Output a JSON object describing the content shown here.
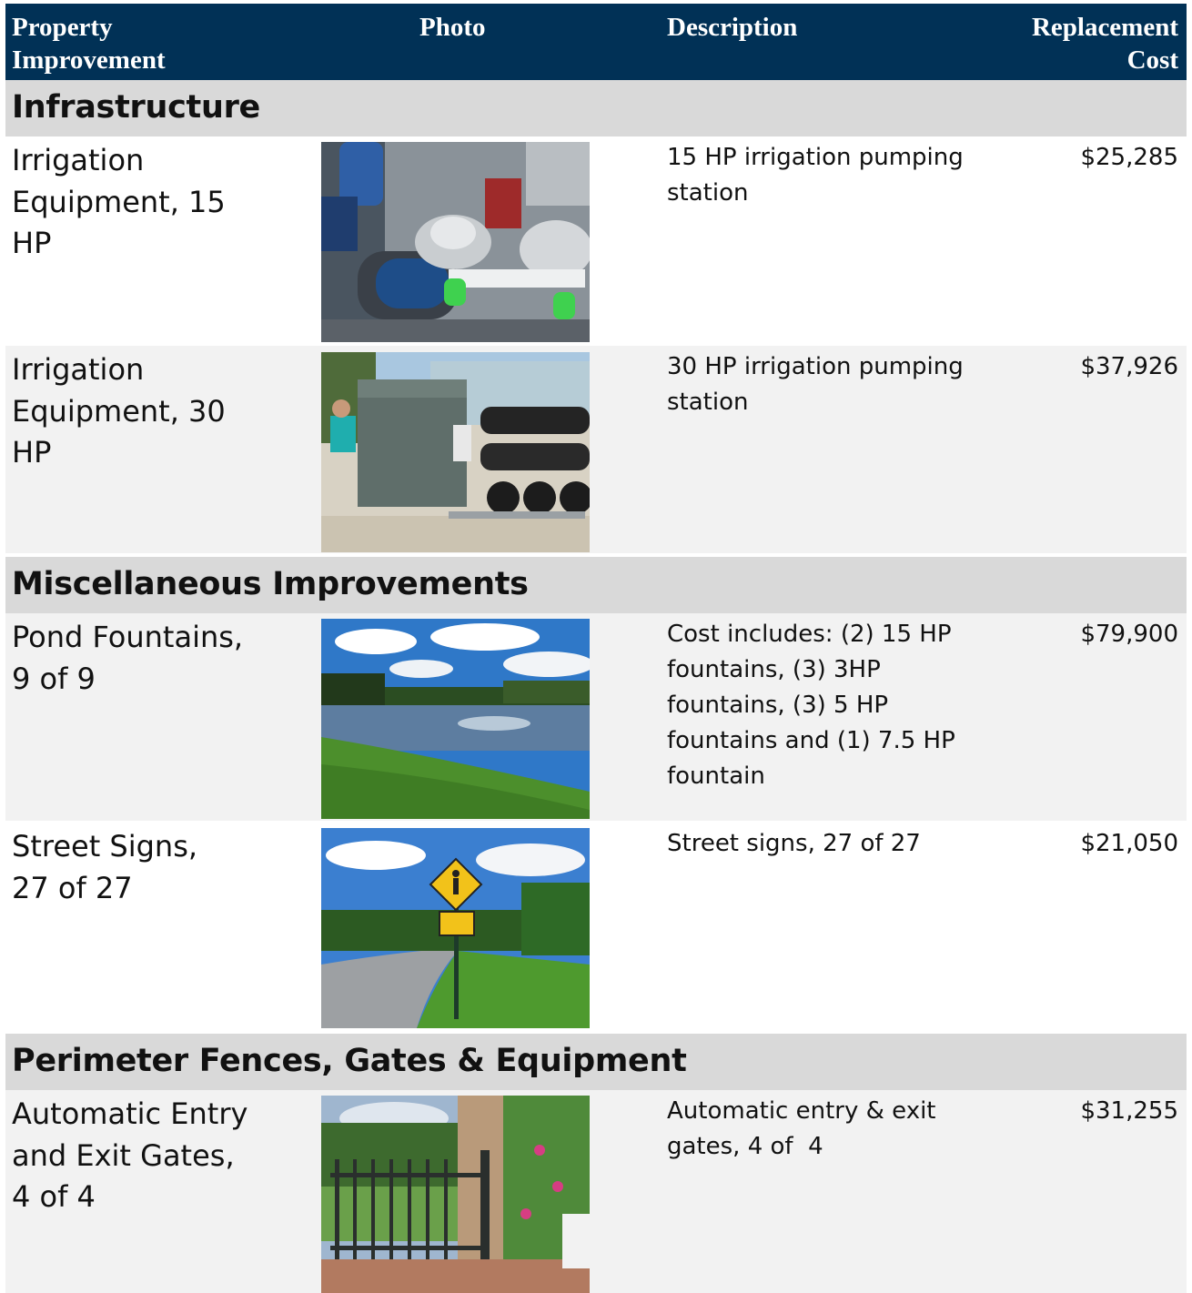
{
  "header": {
    "col_property": "Property Improvement",
    "col_photo": "Photo",
    "col_description": "Description",
    "col_cost": "Replacement Cost"
  },
  "sections": [
    {
      "title": "Infrastructure",
      "rows": [
        {
          "name": "Irrigation Equipment, 15 HP",
          "photo": "irrigation-pump-15hp-photo",
          "description": "15 HP irrigation pumping station",
          "cost": "$25,285"
        },
        {
          "name": "Irrigation Equipment, 30 HP",
          "photo": "irrigation-pump-30hp-photo",
          "description": "30 HP irrigation pumping station",
          "cost": "$37,926"
        }
      ]
    },
    {
      "title": "Miscellaneous Improvements",
      "rows": [
        {
          "name": "Pond Fountains, 9 of 9",
          "photo": "pond-fountain-photo",
          "description": "Cost includes: (2) 15 HP fountains, (3) 3HP fountains, (3) 5 HP fountains and (1) 7.5 HP fountain",
          "cost": "$79,900"
        },
        {
          "name": "Street Signs, 27 of 27",
          "photo": "street-sign-photo",
          "description": "Street signs, 27 of 27",
          "cost": "$21,050"
        }
      ]
    },
    {
      "title": "Perimeter Fences, Gates & Equipment",
      "rows": [
        {
          "name": "Automatic Entry and Exit Gates, 4 of 4",
          "photo": "entry-gate-photo",
          "description": "Automatic entry & exit gates, 4 of  4",
          "cost": "$31,255"
        }
      ]
    }
  ]
}
